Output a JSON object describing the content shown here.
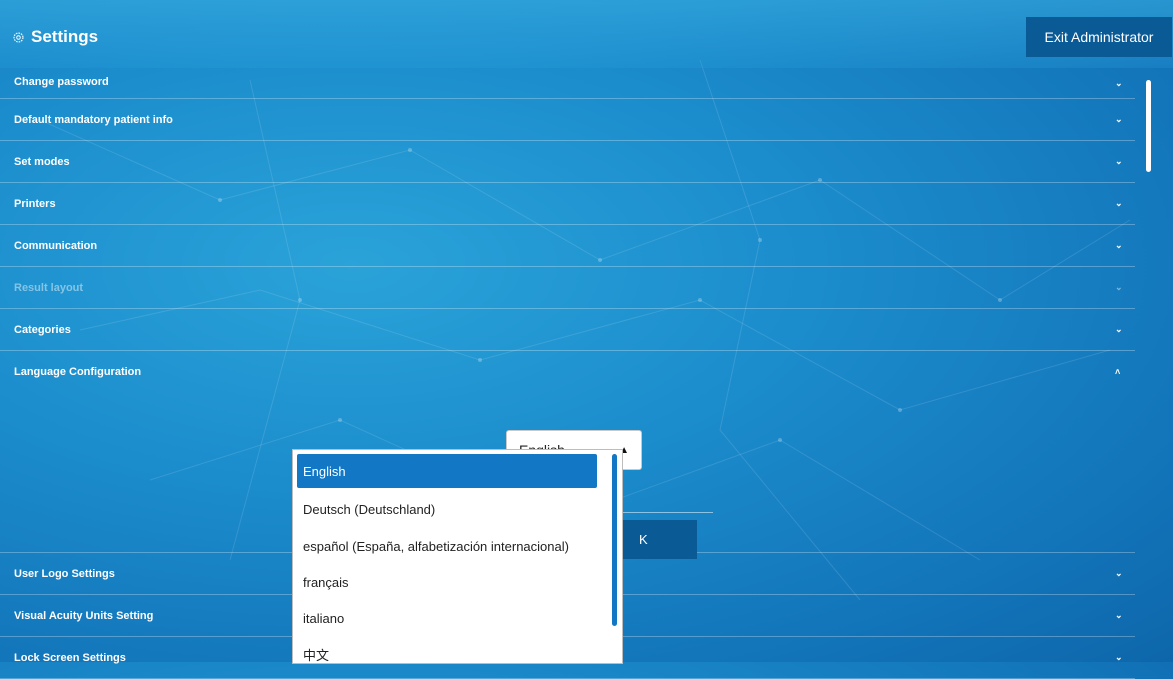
{
  "header": {
    "title": "Settings",
    "exit_label": "Exit Administrator"
  },
  "sections": [
    {
      "label": "Change password",
      "state": "collapsed"
    },
    {
      "label": "Default mandatory patient info",
      "state": "collapsed"
    },
    {
      "label": "Set modes",
      "state": "collapsed"
    },
    {
      "label": "Printers",
      "state": "collapsed"
    },
    {
      "label": "Communication",
      "state": "collapsed"
    },
    {
      "label": "Result layout",
      "state": "disabled"
    },
    {
      "label": "Categories",
      "state": "collapsed"
    },
    {
      "label": "Language Configuration",
      "state": "expanded"
    },
    {
      "label": "User Logo Settings",
      "state": "collapsed"
    },
    {
      "label": "Visual Acuity Units Setting",
      "state": "collapsed"
    },
    {
      "label": "Lock Screen Settings",
      "state": "collapsed"
    }
  ],
  "language": {
    "selected": "English",
    "ok_label": "K",
    "options": [
      "English",
      "Deutsch (Deutschland)",
      "español (España, alfabetización internacional)",
      "français",
      "italiano",
      "中文"
    ]
  },
  "icons": {
    "collapsed": "chevron-down-icon",
    "expanded": "chevron-up-icon",
    "settings": "gear-icon",
    "dropdown": "triangle-up-icon"
  },
  "colors": {
    "accent": "#1277c4",
    "button": "#0a5a96"
  }
}
